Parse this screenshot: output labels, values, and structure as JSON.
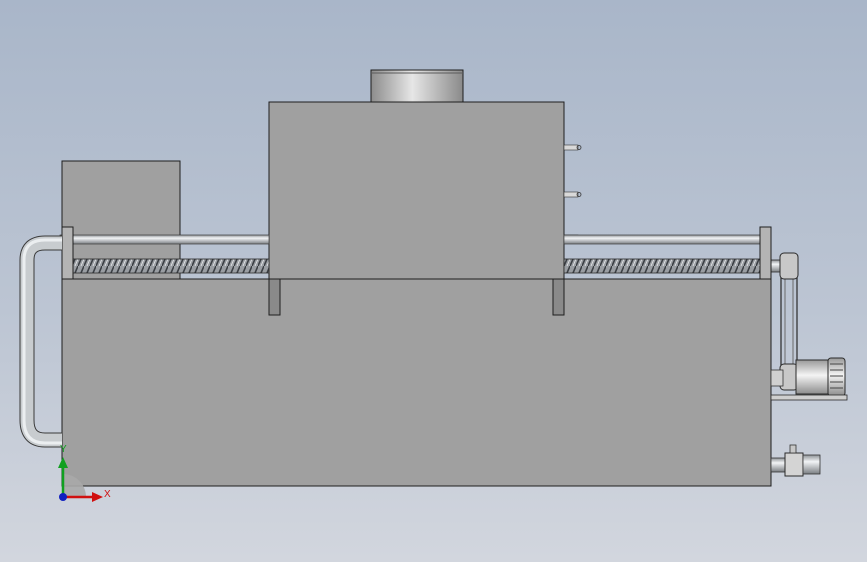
{
  "viewport": {
    "background_top": "#a9b6c9",
    "background_bottom": "#d2d6de"
  },
  "machine": {
    "body_color": "#a0a0a0",
    "edge_color": "#1e1e1e",
    "pipe_color": "#c8cccf",
    "motor_color": "#d9d9d9"
  },
  "triad": {
    "x_label": "X",
    "y_label": "Y",
    "x_color": "#d01010",
    "y_color": "#10a020",
    "origin_color": "#1020c0"
  }
}
